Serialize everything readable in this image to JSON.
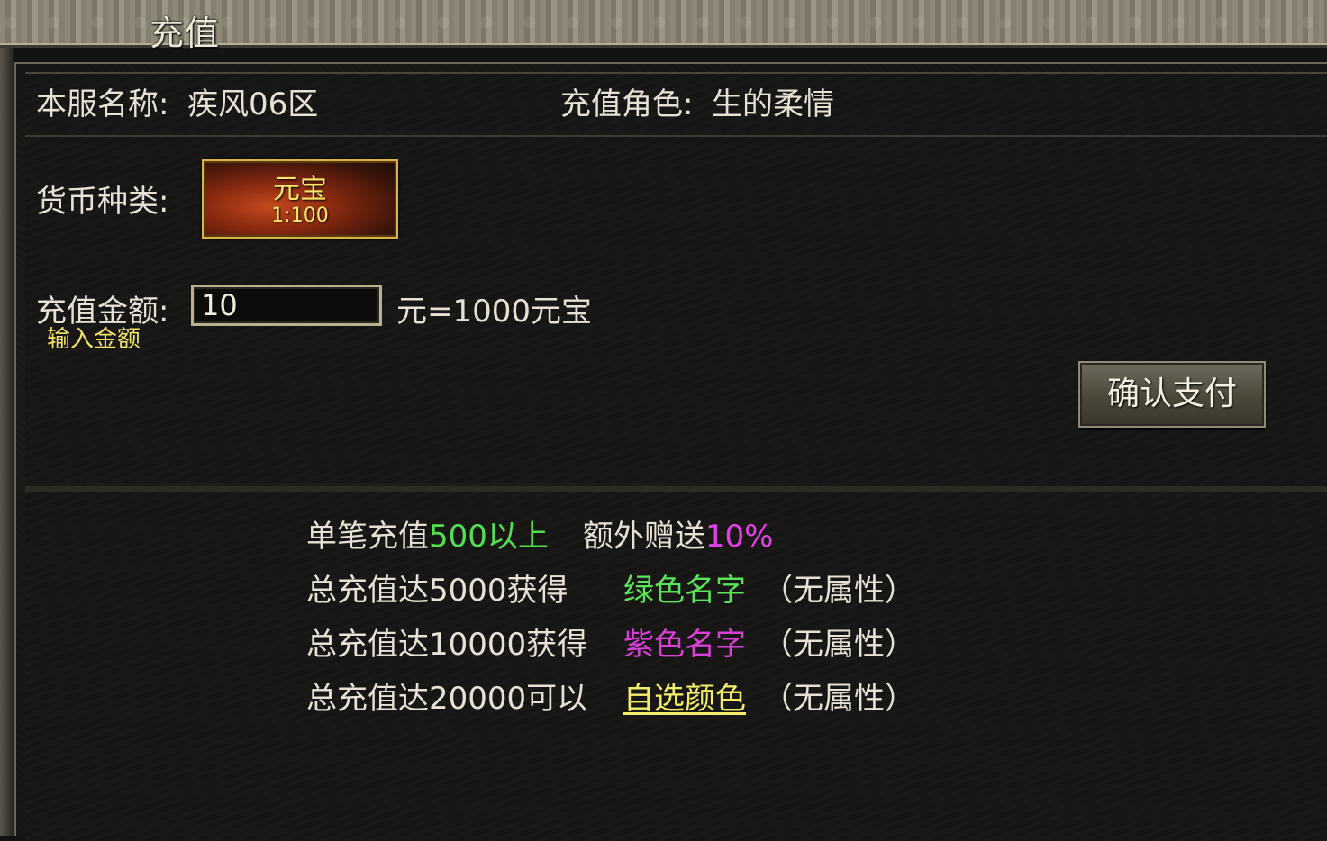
{
  "window": {
    "title": "充值"
  },
  "server": {
    "label": "本服名称:",
    "value": "疾风06区"
  },
  "role": {
    "label": "充值角色:",
    "value": "生的柔情"
  },
  "currency": {
    "label": "货币种类:",
    "name": "元宝",
    "rate": "1:100"
  },
  "amount": {
    "label": "充值金额:",
    "hint": "输入金额",
    "value": "10",
    "result": "元=1000元宝"
  },
  "confirm": {
    "label": "确认支付"
  },
  "info": {
    "line1": {
      "prefix": "单笔充值",
      "amount": "500以上",
      "gap": "额外赠送",
      "bonus": "10%"
    },
    "line2": {
      "prefix": "总充值达5000获得",
      "reward": "绿色名字",
      "note": "（无属性）"
    },
    "line3": {
      "prefix": "总充值达10000获得",
      "reward": "紫色名字",
      "note": "（无属性）"
    },
    "line4": {
      "prefix": "总充值达20000可以",
      "reward": "自选颜色",
      "note": "（无属性）"
    }
  },
  "colors": {
    "green": "#52e052",
    "magenta": "#e040e6",
    "yellow": "#f3ee6a",
    "frame_gold": "#d6b344"
  }
}
